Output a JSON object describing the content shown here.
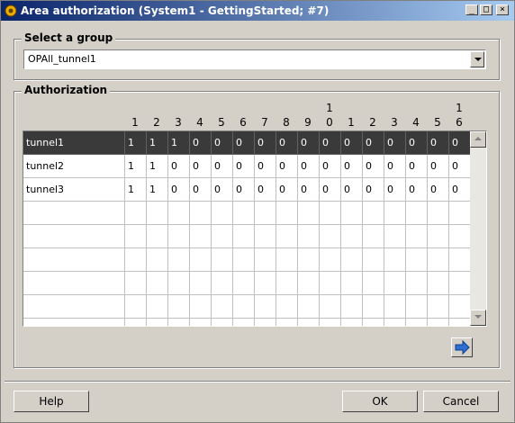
{
  "window": {
    "title": "Area authorization (System1 - GettingStarted; #7)",
    "controls": [
      "_",
      "□",
      "×"
    ]
  },
  "select_group": {
    "legend": "Select a group",
    "value": "OPAll_tunnel1"
  },
  "authorization": {
    "legend": "Authorization",
    "columns": [
      {
        "top": "",
        "bottom": "1"
      },
      {
        "top": "",
        "bottom": "2"
      },
      {
        "top": "",
        "bottom": "3"
      },
      {
        "top": "",
        "bottom": "4"
      },
      {
        "top": "",
        "bottom": "5"
      },
      {
        "top": "",
        "bottom": "6"
      },
      {
        "top": "",
        "bottom": "7"
      },
      {
        "top": "",
        "bottom": "8"
      },
      {
        "top": "",
        "bottom": "9"
      },
      {
        "top": "1",
        "bottom": "0"
      },
      {
        "top": "",
        "bottom": "1"
      },
      {
        "top": "",
        "bottom": "2"
      },
      {
        "top": "",
        "bottom": "3"
      },
      {
        "top": "",
        "bottom": "4"
      },
      {
        "top": "",
        "bottom": "5"
      },
      {
        "top": "1",
        "bottom": "6"
      }
    ],
    "rows": [
      {
        "name": "tunnel1",
        "values": [
          "1",
          "1",
          "1",
          "0",
          "0",
          "0",
          "0",
          "0",
          "0",
          "0",
          "0",
          "0",
          "0",
          "0",
          "0",
          "0"
        ],
        "selected": true
      },
      {
        "name": "tunnel2",
        "values": [
          "1",
          "1",
          "0",
          "0",
          "0",
          "0",
          "0",
          "0",
          "0",
          "0",
          "0",
          "0",
          "0",
          "0",
          "0",
          "0"
        ],
        "selected": false
      },
      {
        "name": "tunnel3",
        "values": [
          "1",
          "1",
          "0",
          "0",
          "0",
          "0",
          "0",
          "0",
          "0",
          "0",
          "0",
          "0",
          "0",
          "0",
          "0",
          "0"
        ],
        "selected": false
      },
      {
        "name": "",
        "values": [
          "",
          "",
          "",
          "",
          "",
          "",
          "",
          "",
          "",
          "",
          "",
          "",
          "",
          "",
          "",
          ""
        ],
        "selected": false
      },
      {
        "name": "",
        "values": [
          "",
          "",
          "",
          "",
          "",
          "",
          "",
          "",
          "",
          "",
          "",
          "",
          "",
          "",
          "",
          ""
        ],
        "selected": false
      },
      {
        "name": "",
        "values": [
          "",
          "",
          "",
          "",
          "",
          "",
          "",
          "",
          "",
          "",
          "",
          "",
          "",
          "",
          "",
          ""
        ],
        "selected": false
      },
      {
        "name": "",
        "values": [
          "",
          "",
          "",
          "",
          "",
          "",
          "",
          "",
          "",
          "",
          "",
          "",
          "",
          "",
          "",
          ""
        ],
        "selected": false
      },
      {
        "name": "",
        "values": [
          "",
          "",
          "",
          "",
          "",
          "",
          "",
          "",
          "",
          "",
          "",
          "",
          "",
          "",
          "",
          ""
        ],
        "selected": false
      },
      {
        "name": "",
        "values": [
          "",
          "",
          "",
          "",
          "",
          "",
          "",
          "",
          "",
          "",
          "",
          "",
          "",
          "",
          "",
          ""
        ],
        "selected": false
      }
    ],
    "next_icon": "arrow-right-icon"
  },
  "buttons": {
    "help": "Help",
    "ok": "OK",
    "cancel": "Cancel"
  },
  "colors": {
    "selection": "#3a3a3a",
    "title_start": "#0a246a",
    "title_end": "#a6caf0",
    "arrow_blue": "#2f6fd0"
  }
}
